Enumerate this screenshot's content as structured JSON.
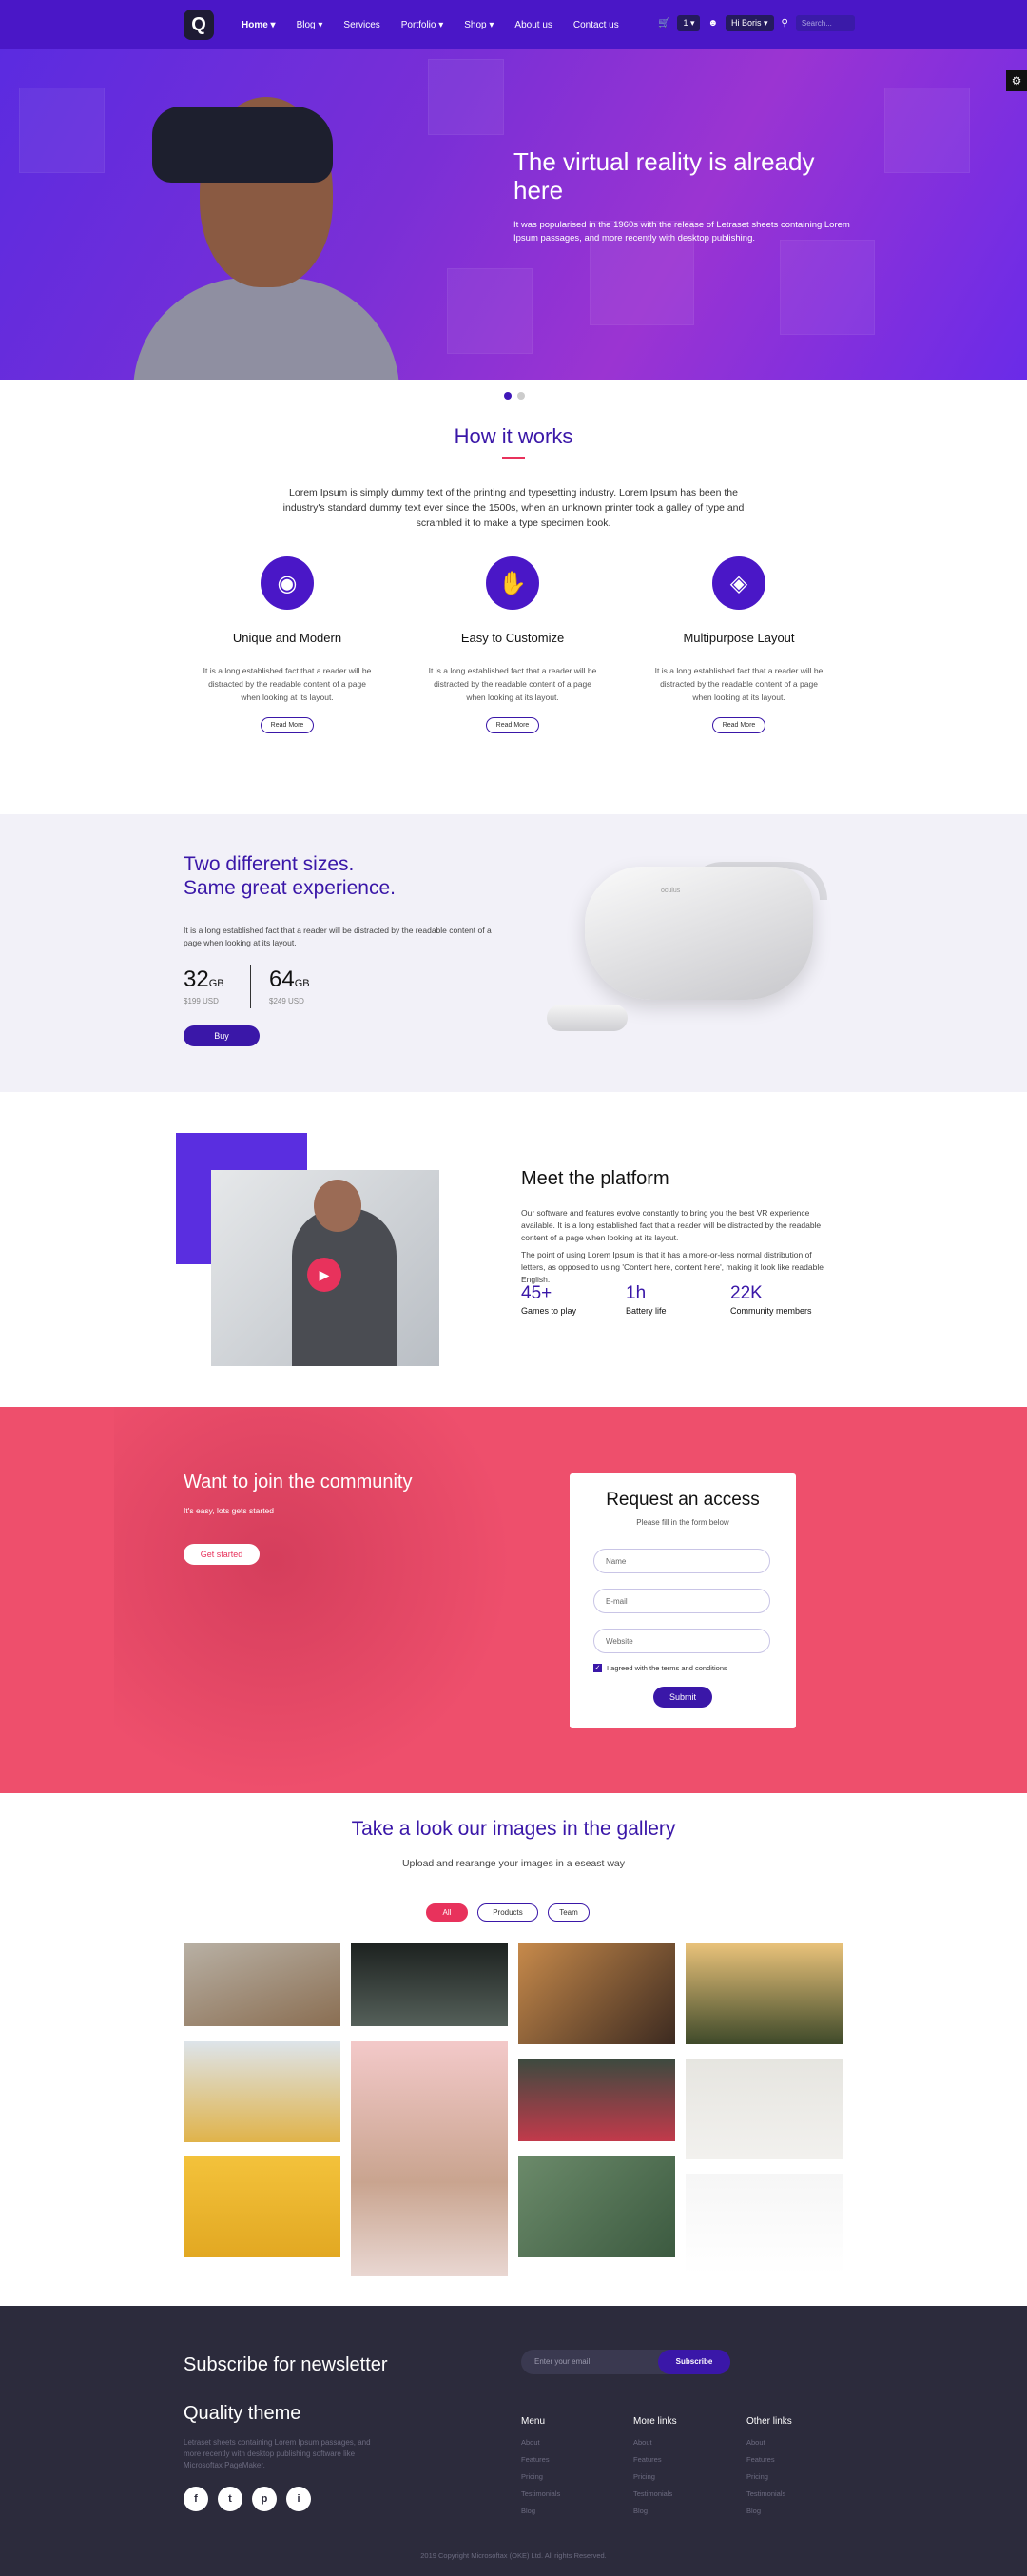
{
  "nav": {
    "logo": "Q",
    "menu": [
      "Home ▾",
      "Blog ▾",
      "Services",
      "Portfolio ▾",
      "Shop ▾",
      "About us",
      "Contact us"
    ],
    "cart_count": "1 ▾",
    "user": "Hi Boris ▾",
    "search_placeholder": "Search..."
  },
  "hero": {
    "title": "The virtual reality is already here",
    "text": "It was popularised in the 1960s with the release of Letraset sheets containing Lorem Ipsum passages, and more recently with desktop publishing."
  },
  "how": {
    "title": "How it works",
    "text": "Lorem Ipsum is simply dummy text of the printing and typesetting industry. Lorem Ipsum has been the industry's standard dummy text ever since the 1500s, when an unknown printer took a galley of type and scrambled it to make a type specimen book.",
    "features": [
      {
        "icon": "fingerprint-icon",
        "title": "Unique and Modern",
        "text": "It is a long established fact that a reader will be distracted by the readable content of a page when looking at its layout.",
        "button": "Read More"
      },
      {
        "icon": "hand-icon",
        "title": "Easy to Customize",
        "text": "It is a long established fact that a reader will be distracted by the readable content of a page when looking at its layout.",
        "button": "Read More"
      },
      {
        "icon": "layers-icon",
        "title": "Multipurpose Layout",
        "text": "It is a long established fact that a reader will be distracted by the readable content of a page when looking at its layout.",
        "button": "Read More"
      }
    ]
  },
  "sizes": {
    "title_line1": "Two different sizes.",
    "title_line2": "Same great experience.",
    "text": "It is a long established fact that a reader will be distracted by the readable content of a page when looking at its layout.",
    "small": {
      "value": "32",
      "unit": "GB",
      "price": "$199 USD"
    },
    "large": {
      "value": "64",
      "unit": "GB",
      "price": "$249 USD"
    },
    "button": "Buy",
    "device_brand": "oculus"
  },
  "platform": {
    "title": "Meet the platform",
    "p1": "Our software and features evolve constantly to bring you the best VR experience available. It is a long established fact that a reader will be distracted by the readable content of a page when looking at its layout.",
    "p2": "The point of using Lorem Ipsum is that it has a more-or-less normal distribution of letters, as opposed to using 'Content here, content here', making it look like readable English.",
    "stats": [
      {
        "value": "45+",
        "label": "Games to play"
      },
      {
        "value": "1h",
        "label": "Battery life"
      },
      {
        "value": "22K",
        "label": "Community members"
      }
    ]
  },
  "community": {
    "title": "Want to join the community",
    "subtitle": "It's easy, lots gets started",
    "button": "Get started",
    "form": {
      "title": "Request an access",
      "subtitle": "Please fill in the form below",
      "name_placeholder": "Name",
      "email_placeholder": "E-mail",
      "website_placeholder": "Website",
      "terms": "I agreed with the terms and conditions",
      "submit": "Submit"
    }
  },
  "gallery": {
    "title": "Take a look our images in the gallery",
    "subtitle": "Upload and rearange your images in a eseast way",
    "filters": [
      "All",
      "Products",
      "Team"
    ]
  },
  "footer": {
    "newsletter": "Subscribe for newsletter",
    "email_placeholder": "Enter your email",
    "subscribe": "Subscribe",
    "brand": "Quality theme",
    "desc": "Letraset sheets containing Lorem Ipsum passages, and more recently with desktop publishing software like Microsoftax PageMaker.",
    "socials": [
      "f",
      "t",
      "p",
      "i"
    ],
    "columns": [
      {
        "title": "Menu",
        "items": [
          "About",
          "Features",
          "Pricing",
          "Testimonials",
          "Blog"
        ]
      },
      {
        "title": "More links",
        "items": [
          "About",
          "Features",
          "Pricing",
          "Testimonials",
          "Blog"
        ]
      },
      {
        "title": "Other links",
        "items": [
          "About",
          "Features",
          "Pricing",
          "Testimonials",
          "Blog"
        ]
      }
    ],
    "copyright": "2019 Copyright Microsoftax (OKE) Ltd. All rights Reserved."
  },
  "colors": {
    "primary": "#4a17c7",
    "accent": "#e8325c",
    "footer": "#2c2b3c"
  }
}
